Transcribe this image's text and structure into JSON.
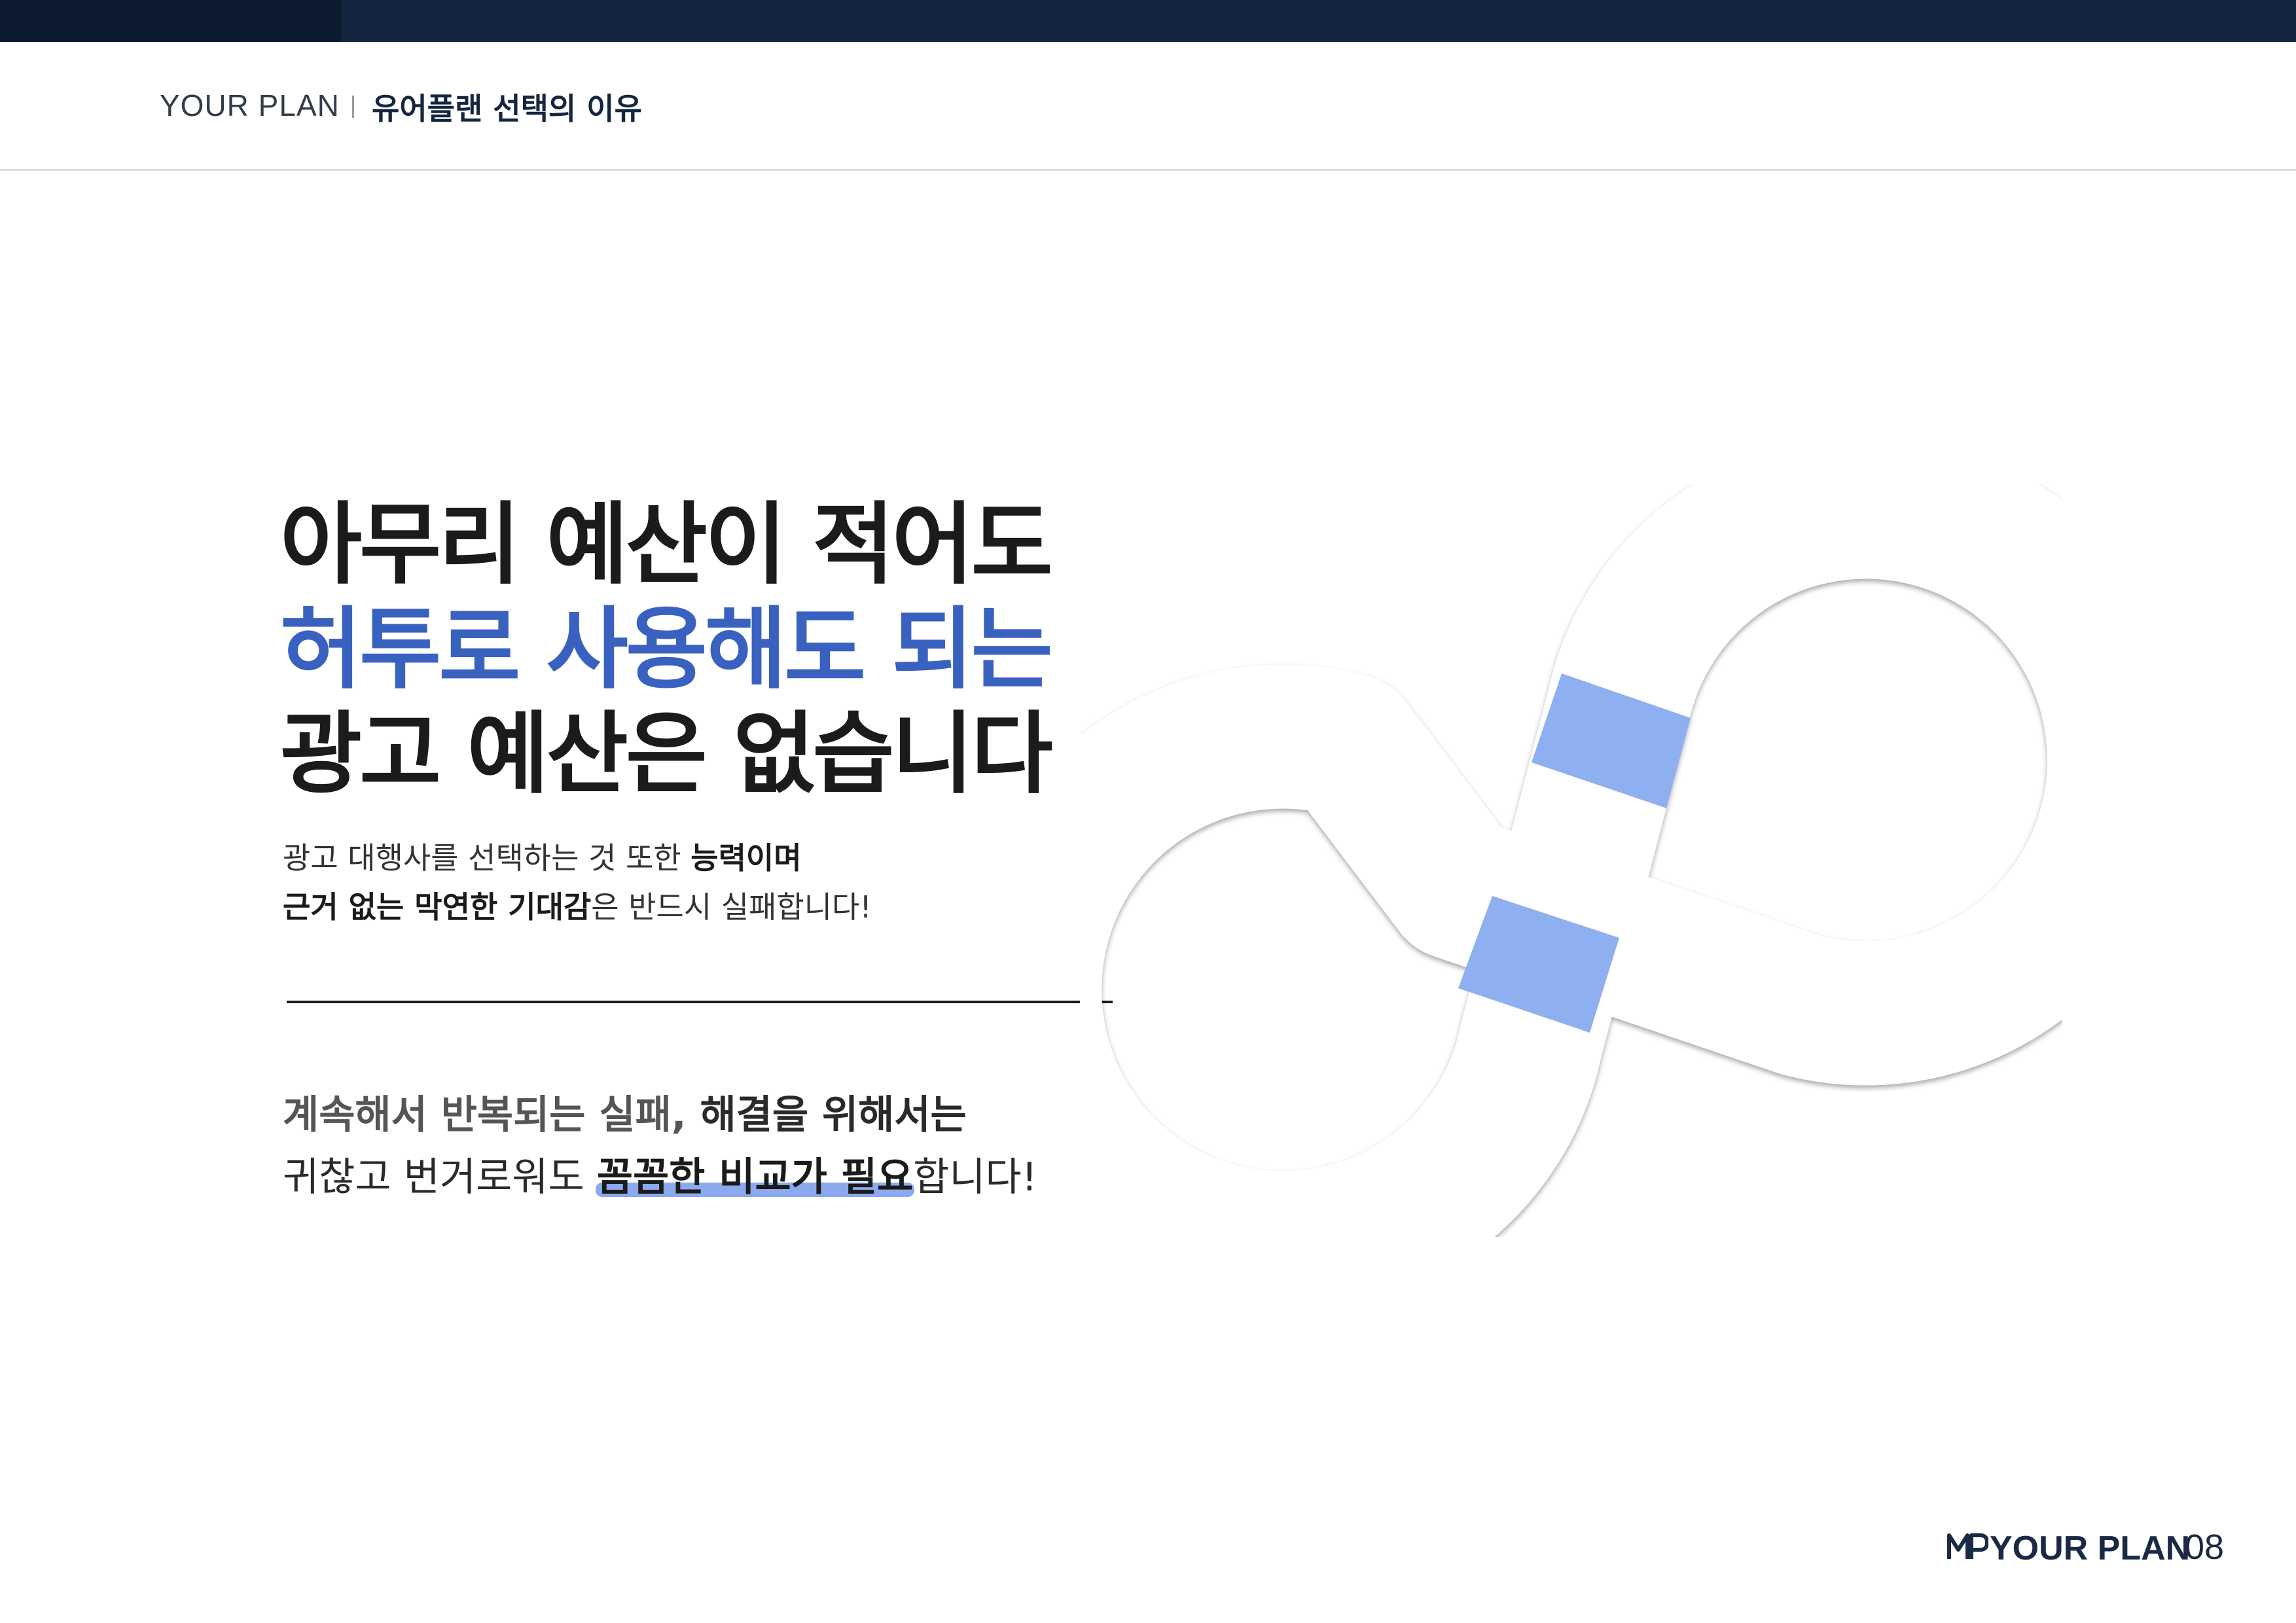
{
  "header": {
    "brand": "YOUR PLAN",
    "section": "유어플랜 선택의 이유"
  },
  "headline": {
    "line1": "아무리 예산이 적어도",
    "line2": "허투로 사용해도 되는",
    "line3": "광고 예산은 없습니다"
  },
  "intro": {
    "line1_normal": "광고 대행사를 선택하는 것 또한 ",
    "line1_bold": "능력이며",
    "line2_bold1": "근거 없는 막연한 기대감",
    "line2_normal": "은 반드시 실패합니다!"
  },
  "statement": {
    "line1_gray": "계속해서 반복되는 실패, ",
    "line1_dark": "해결을 위해서는",
    "line2_start": "귀찮고 번거로워도 ",
    "line2_highlight": "꼼꼼한 비교가 필요",
    "line2_end": "합니다!"
  },
  "footer": {
    "brand": "YOUR PLAN",
    "page": "08"
  },
  "colors": {
    "navy": "#14263f",
    "accent_blue": "#3962c0",
    "highlight": "#8ba9ee"
  },
  "icons": [
    "infinity-graphic",
    "yourplan-logo-icon"
  ]
}
